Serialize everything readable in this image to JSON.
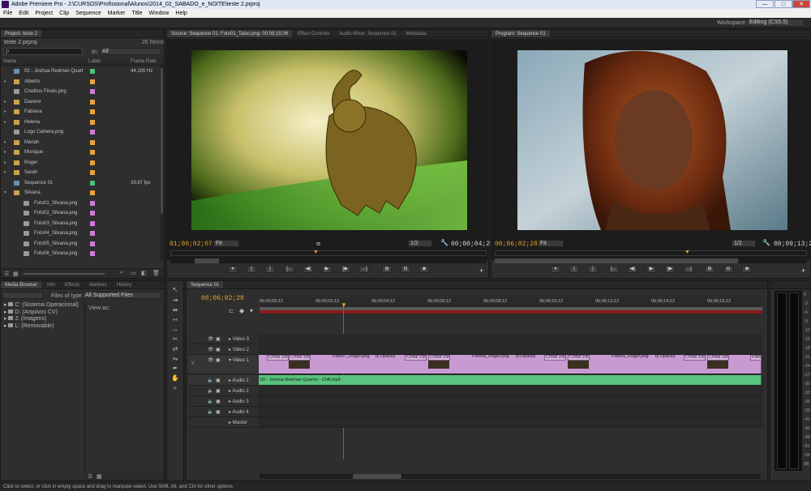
{
  "app": {
    "title": "Adobe Premiere Pro - J:\\CURSOS\\Profissional\\Alunos\\2014_02_SABADO_e_NOITE\\teste 2.prproj",
    "window_controls": [
      "—",
      "□",
      "✕"
    ]
  },
  "menu": [
    "File",
    "Edit",
    "Project",
    "Clip",
    "Sequence",
    "Marker",
    "Title",
    "Window",
    "Help"
  ],
  "workspace": {
    "label": "Workspace:",
    "value": "Editing (CS5.5)"
  },
  "project": {
    "tab": "Project: teste 2",
    "file": "teste 2.prproj",
    "items_count": "26 Items",
    "search_placeholder": "ρ",
    "in_label": "In:",
    "in_value": "All",
    "columns": {
      "name": "Name",
      "label": "Label",
      "frame_rate": "Frame Rate"
    },
    "items": [
      {
        "name": "02 - Joshua Redman Quart",
        "type": "audio",
        "label_color": "#47c47a",
        "frame_rate": "44.100 Hz"
      },
      {
        "name": "Alberto",
        "type": "folder",
        "label_color": "#e8a33a",
        "frame_rate": ""
      },
      {
        "name": "Creditos Finais.png",
        "type": "file",
        "label_color": "#d27ad8",
        "frame_rate": ""
      },
      {
        "name": "Davenir",
        "type": "folder",
        "label_color": "#e8a33a",
        "frame_rate": ""
      },
      {
        "name": "Fabiana",
        "type": "folder",
        "label_color": "#e8a33a",
        "frame_rate": ""
      },
      {
        "name": "Helena",
        "type": "folder",
        "label_color": "#e8a33a",
        "frame_rate": ""
      },
      {
        "name": "Logo Camera.png",
        "type": "file",
        "label_color": "#d27ad8",
        "frame_rate": ""
      },
      {
        "name": "Mariah",
        "type": "folder",
        "label_color": "#e8a33a",
        "frame_rate": ""
      },
      {
        "name": "Monique",
        "type": "folder",
        "label_color": "#e8a33a",
        "frame_rate": ""
      },
      {
        "name": "Roger",
        "type": "folder",
        "label_color": "#e8a33a",
        "frame_rate": ""
      },
      {
        "name": "Sarah",
        "type": "folder",
        "label_color": "#e8a33a",
        "frame_rate": ""
      },
      {
        "name": "Sequence 01",
        "type": "sequence",
        "label_color": "#47c47a",
        "frame_rate": "29,97 fps"
      },
      {
        "name": "Silvana",
        "type": "folder",
        "label_color": "#e8a33a",
        "frame_rate": ""
      },
      {
        "name": "Foto01_Silvana.png",
        "type": "file",
        "label_color": "#d27ad8",
        "frame_rate": ""
      },
      {
        "name": "Foto02_Silvana.png",
        "type": "file",
        "label_color": "#d27ad8",
        "frame_rate": ""
      },
      {
        "name": "Foto03_Silvana.png",
        "type": "file",
        "label_color": "#d27ad8",
        "frame_rate": ""
      },
      {
        "name": "Foto04_Silvana.png",
        "type": "file",
        "label_color": "#d27ad8",
        "frame_rate": ""
      },
      {
        "name": "Foto05_Silvana.png",
        "type": "file",
        "label_color": "#d27ad8",
        "frame_rate": ""
      },
      {
        "name": "Foto06_Silvana.png",
        "type": "file",
        "label_color": "#d27ad8",
        "frame_rate": ""
      }
    ]
  },
  "source_monitor": {
    "tabs": [
      "Source: Sequence 01: Foto01_Taioo.png: 00;08;15;06",
      "Effect Controls",
      "Audio Mixer: Sequence 01",
      "Metadata"
    ],
    "timecode": "01;00;02;07",
    "fit": "Fit",
    "resolution": "1/2",
    "duration": "00;00;04;29"
  },
  "program_monitor": {
    "tab": "Program: Sequence 01",
    "timecode": "00;06;02;28",
    "fit": "Fit",
    "resolution": "1/2",
    "duration": "00;09;13;21"
  },
  "media_browser": {
    "tabs": [
      "Media Browser",
      "Info",
      "Effects",
      "Markers",
      "History"
    ],
    "files_of_type_label": "Files of type:",
    "files_of_type_value": "All Supported Files",
    "view_as_label": "View as:",
    "drives": [
      "C: (Sistema Operacional)",
      "D: (Arquivos CV)",
      "J: (Imagens)",
      "L: (Removable)"
    ]
  },
  "timeline": {
    "tab": "Sequence 01",
    "timecode": "00;06;02;28",
    "ruler": [
      "00;06;00;12",
      "00;06;02;12",
      "00;06;04;12",
      "00;06;06;12",
      "00;06;08;12",
      "00;06;10;12",
      "00;06;12;12",
      "00;06;14;12",
      "00;06;16;12"
    ],
    "tracks": {
      "video3": "Video 3",
      "video2": "Video 2",
      "video1": "Video 1",
      "audio1": "Audio 1",
      "audio2": "Audio 2",
      "audio3": "Audio 3",
      "audio4": "Audio 4",
      "master": "Master"
    },
    "video1_clips": [
      "Cross Zoo",
      "Cross Zoom",
      "Foto07_Roger.png",
      "ty:Opacity",
      "Cross Zoo",
      "Cross Zoom",
      "Foto08_Roger.png",
      "ty:Opacity",
      "Cross Zoo",
      "Cross Zoom",
      "Foto09_Roger.png",
      "ty:Opacity",
      "Cross Zoo",
      "Cross Zoom",
      "Foto"
    ],
    "audio1_clip": "02 - Joshua Redman Quartet - Chill.mp3"
  },
  "audio_meter": {
    "labels": [
      "0",
      "-3",
      "-6",
      "-9",
      "-12",
      "-15",
      "-18",
      "-21",
      "-24",
      "-27",
      "-30",
      "-33",
      "-36",
      "-39",
      "-42",
      "-45",
      "-48",
      "-51",
      "-54",
      "dB"
    ]
  },
  "status_bar": "Click to select, or click in empty space and drag to marquee select. Use Shift, Alt, and Ctrl for other options."
}
